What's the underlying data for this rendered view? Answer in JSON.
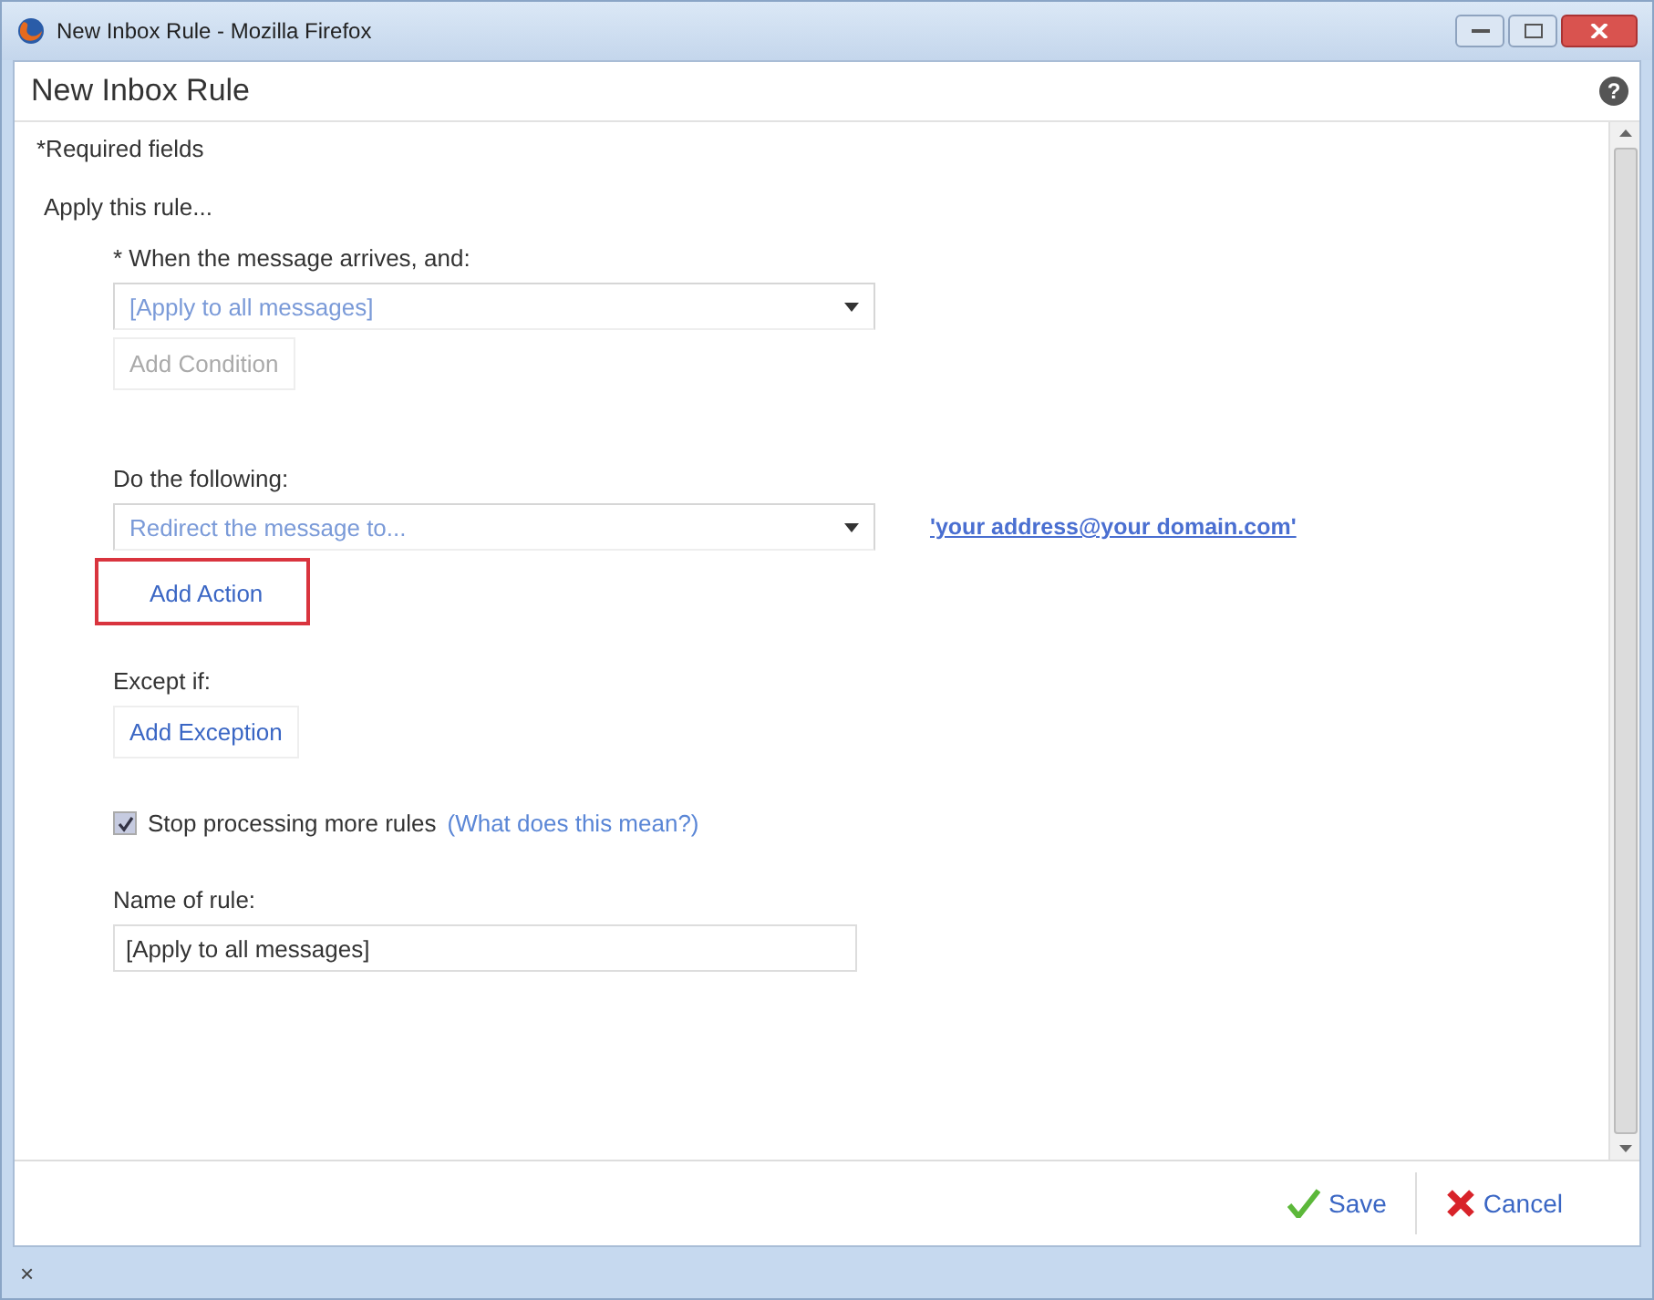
{
  "window": {
    "title": "New Inbox Rule - Mozilla Firefox"
  },
  "header": {
    "title": "New Inbox Rule",
    "help": "?"
  },
  "required_note": "*Required fields",
  "apply_label": "Apply this rule...",
  "condition": {
    "label": "* When the message arrives, and:",
    "value": "[Apply to all messages]",
    "button": {
      "label": "Add Condition",
      "disabled": true,
      "highlighted": false
    }
  },
  "action": {
    "label": "Do the following:",
    "value": "Redirect the message to...",
    "link": "'your address@your domain.com'",
    "button": {
      "label": "Add Action",
      "disabled": false,
      "highlighted": true
    }
  },
  "exception": {
    "label": "Except if:",
    "button": {
      "label": "Add Exception",
      "disabled": false,
      "highlighted": false
    }
  },
  "stop_processing": {
    "checked": true,
    "label": "Stop processing more rules",
    "link": "(What does this mean?)"
  },
  "rule_name": {
    "label": "Name of rule:",
    "value": "[Apply to all messages]"
  },
  "footer": {
    "save": "Save",
    "cancel": "Cancel"
  },
  "status_bar": {
    "close": "×"
  }
}
